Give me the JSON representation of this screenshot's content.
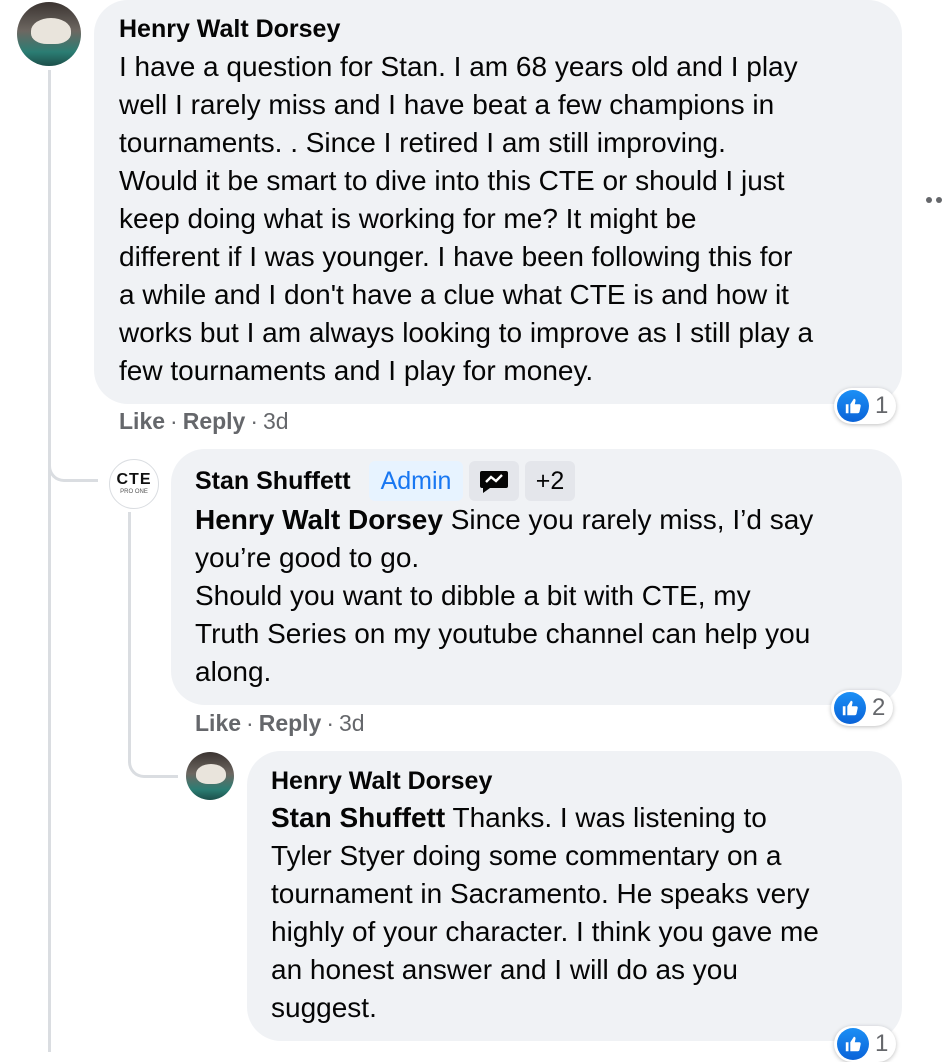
{
  "comments": [
    {
      "author": "Henry Walt Dorsey",
      "lines": [
        "I have a question for Stan. I am 68 years old and I play",
        "well I rarely miss and I have beat a few champions in",
        "tournaments. . Since I retired I am still improving.",
        "Would it be smart to dive into this CTE or should I just",
        "keep doing what is working for me? It might be",
        "different if I was younger. I have been following this for",
        "a while and I don't have a clue what CTE is and how it",
        "works but I am always looking to improve as I still play a",
        "few tournaments and I play for money."
      ],
      "like_label": "Like",
      "reply_label": "Reply",
      "timestamp": "3d",
      "reaction_count": "1"
    },
    {
      "author": "Stan Shuffett",
      "admin_badge": "Admin",
      "badge_more": "+2",
      "mention": "Henry Walt Dorsey",
      "first_line_rest": " Since you rarely miss, I’d say",
      "lines": [
        "you’re good to go.",
        "Should you want to dibble a bit with CTE, my",
        "Truth Series on my youtube channel can help you",
        "along."
      ],
      "avatar_text": "CTE",
      "avatar_subtext": "PRO ONE",
      "like_label": "Like",
      "reply_label": "Reply",
      "timestamp": "3d",
      "reaction_count": "2"
    },
    {
      "author": "Henry Walt Dorsey",
      "mention": "Stan Shuffett",
      "first_line_rest": " Thanks. I was listening to",
      "lines": [
        "Tyler Styer doing some commentary on a",
        "tournament in Sacramento. He speaks very",
        "highly of your character. I think you gave me",
        "an honest answer and I will do as you",
        "suggest."
      ],
      "reaction_count": "1"
    }
  ],
  "colors": {
    "bubble": "#f0f2f5",
    "admin_badge_bg": "#e7f3ff",
    "admin_badge_text": "#1877f2",
    "like_blue": "#1877f2",
    "secondary_text": "#65676b"
  },
  "icons": [
    "like-thumb-icon",
    "more-options-icon",
    "badge-chat-icon"
  ]
}
